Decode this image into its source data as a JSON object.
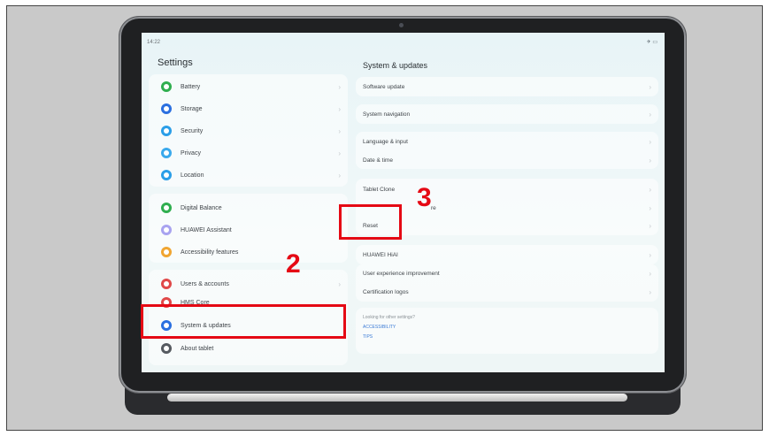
{
  "status": {
    "time": "14:22",
    "icons": "✈ ▭"
  },
  "left": {
    "title": "Settings",
    "items": [
      {
        "label": "Battery",
        "color": "#2fae4f"
      },
      {
        "label": "Storage",
        "color": "#2a6fe0"
      },
      {
        "label": "Security",
        "color": "#2a9ee8"
      },
      {
        "label": "Privacy",
        "color": "#3aa9ec"
      },
      {
        "label": "Location",
        "color": "#2a9ee8"
      },
      {
        "label": "Digital Balance",
        "color": "#2fae4f"
      },
      {
        "label": "HUAWEI Assistant",
        "color": "#a8a3f0"
      },
      {
        "label": "Accessibility features",
        "color": "#f0a531"
      },
      {
        "label": "Users & accounts",
        "color": "#e04848"
      },
      {
        "label": "HMS Core",
        "color": "#e04848"
      },
      {
        "label": "System & updates",
        "color": "#2a6fe0"
      },
      {
        "label": "About tablet",
        "color": "#555a60"
      }
    ]
  },
  "right": {
    "title": "System & updates",
    "items": [
      "Software update",
      "System navigation",
      "Language & input",
      "Date & time",
      "Tablet Clone",
      "re",
      "Reset",
      "HUAWEI HiAI",
      "User experience improvement",
      "Certification logos"
    ],
    "hint": "Looking for other settings?",
    "links": [
      "ACCESSIBILITY",
      "TIPS"
    ]
  },
  "annotations": {
    "step2": "2",
    "step3": "3"
  }
}
